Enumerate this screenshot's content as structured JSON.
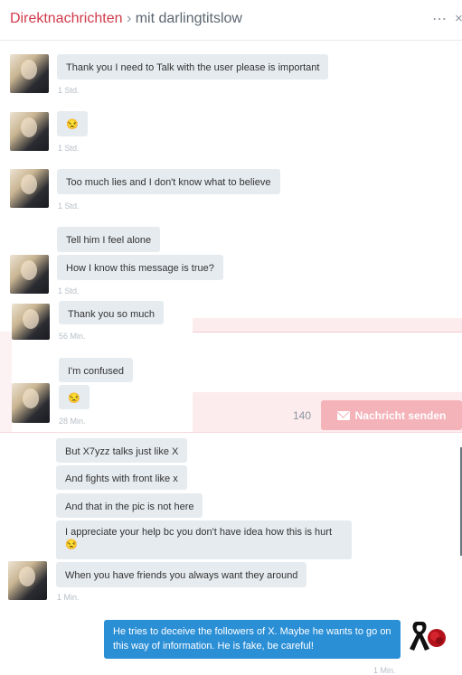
{
  "header": {
    "title": "Direktnachrichten",
    "separator": " › ",
    "recipient": "mit darlingtitslow",
    "more_icon": "⋯",
    "close_icon": "×"
  },
  "messages": [
    {
      "text": "Thank you I need to Talk with the user please is important",
      "time": "1 Std."
    },
    {
      "text": "😒",
      "time": "1 Std."
    },
    {
      "text": "Too much lies and I don't know what to believe",
      "time": "1 Std."
    },
    {
      "text": "Tell him I feel alone",
      "time": ""
    },
    {
      "text": "How I know this message is true?",
      "time": "1 Std."
    },
    {
      "text": "Thank you so much",
      "time": "56 Min."
    },
    {
      "text": "I'm confused",
      "time": ""
    },
    {
      "text": "😒",
      "time": "28 Min."
    },
    {
      "text": "But X7yzz talks just like X",
      "time": ""
    },
    {
      "text": "And fights with front like x",
      "time": ""
    },
    {
      "text": "And that in the pic is not here",
      "time": ""
    },
    {
      "text": "I appreciate your help bc you don't have idea how this is hurt 😒",
      "time": ""
    },
    {
      "text": "When you have friends you always want they around",
      "time": "1 Min."
    }
  ],
  "composer": {
    "counter": "140",
    "send_label": "Nachricht senden"
  },
  "my_message": {
    "text": "He tries to deceive the followers of X. Maybe he wants to go on this way of information. He is fake, be careful!",
    "time": "1 Min."
  },
  "colors": {
    "accent": "#d03a4a",
    "bubble": "#e6ebef",
    "my_bubble": "#2b8fd6",
    "send_button": "#f4b2b9"
  }
}
